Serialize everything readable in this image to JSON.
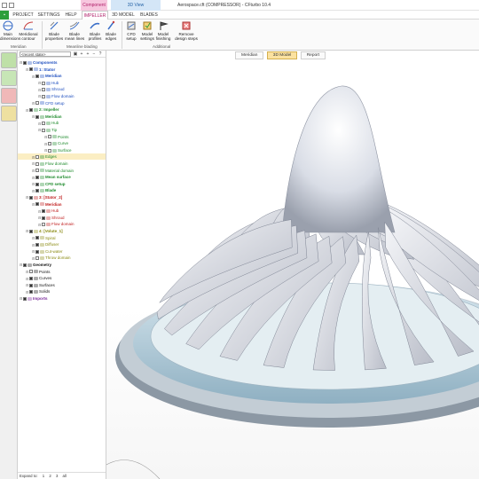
{
  "window": {
    "title": "Aerospace.cft (COMPRESSOR) - CFturbo 10.4",
    "context_component": "Component",
    "context_3d": "3D View"
  },
  "ribbon_tabs": [
    "PROJECT",
    "SETTINGS",
    "HELP",
    "IMPELLER",
    "3D MODEL",
    "BLADES"
  ],
  "ribbon": {
    "buttons": [
      {
        "label": "Main\ndimensions",
        "icon": "main-dimensions-icon"
      },
      {
        "label": "Meridional\ncontour",
        "icon": "meridional-contour-icon"
      },
      {
        "label": "Blade\nproperties",
        "icon": "blade-properties-icon"
      },
      {
        "label": "Blade\nmean lines",
        "icon": "blade-mean-lines-icon"
      },
      {
        "label": "Blade\nprofiles",
        "icon": "blade-profiles-icon"
      },
      {
        "label": "Blade\nedges",
        "icon": "blade-edges-icon"
      },
      {
        "label": "CFD\nsetup",
        "icon": "cfd-setup-icon"
      },
      {
        "label": "Model\nsettings",
        "icon": "model-settings-icon"
      },
      {
        "label": "Model\nfinishing",
        "icon": "model-finishing-icon"
      },
      {
        "label": "Remove\ndesign steps",
        "icon": "remove-design-steps-icon"
      }
    ],
    "groups": [
      "Meridian",
      "Meanline blading",
      "Additional"
    ]
  },
  "tree": {
    "state_select": "<recent state>",
    "items": [
      {
        "label": "Components",
        "color": "#1f4fbf",
        "indent": 0,
        "checked": true,
        "bold": true
      },
      {
        "label": "1: Stator",
        "color": "#1f4fbf",
        "indent": 1,
        "checked": true,
        "bold": true
      },
      {
        "label": "Meridian",
        "color": "#1f4fbf",
        "indent": 2,
        "checked": true,
        "bold": true
      },
      {
        "label": "Hub",
        "color": "#1f4fbf",
        "indent": 3,
        "checked": false
      },
      {
        "label": "Shroud",
        "color": "#1f4fbf",
        "indent": 3,
        "checked": false
      },
      {
        "label": "Flow domain",
        "color": "#1f4fbf",
        "indent": 3,
        "checked": false
      },
      {
        "label": "CFD setup",
        "color": "#1f4fbf",
        "indent": 2,
        "checked": false
      },
      {
        "label": "2: Impeller",
        "color": "#1d8a2b",
        "indent": 1,
        "checked": true,
        "bold": true
      },
      {
        "label": "Meridian",
        "color": "#1d8a2b",
        "indent": 2,
        "checked": true,
        "bold": true
      },
      {
        "label": "Hub",
        "color": "#1d8a2b",
        "indent": 3,
        "checked": false
      },
      {
        "label": "Tip",
        "color": "#1d8a2b",
        "indent": 3,
        "checked": false
      },
      {
        "label": "Points",
        "color": "#1d8a2b",
        "indent": 4,
        "checked": false
      },
      {
        "label": "Curve",
        "color": "#1d8a2b",
        "indent": 4,
        "checked": false
      },
      {
        "label": "Surface",
        "color": "#1d8a2b",
        "indent": 4,
        "checked": false
      },
      {
        "label": "Edges",
        "color": "#1d8a2b",
        "indent": 2,
        "checked": false,
        "highlight": true
      },
      {
        "label": "Flow domain",
        "color": "#1d8a2b",
        "indent": 2,
        "checked": false
      },
      {
        "label": "Material domain",
        "color": "#1d8a2b",
        "indent": 2,
        "checked": false
      },
      {
        "label": "Mean surface",
        "color": "#1d8a2b",
        "indent": 2,
        "checked": true,
        "bold": true
      },
      {
        "label": "CFD setup",
        "color": "#1d8a2b",
        "indent": 2,
        "checked": true,
        "bold": true
      },
      {
        "label": "Blade",
        "color": "#1d8a2b",
        "indent": 2,
        "checked": true,
        "bold": true
      },
      {
        "label": "3: [Stator_2]",
        "color": "#c02020",
        "indent": 1,
        "checked": true,
        "bold": true
      },
      {
        "label": "Meridian",
        "color": "#c02020",
        "indent": 2,
        "checked": true,
        "bold": true
      },
      {
        "label": "Hub",
        "color": "#c02020",
        "indent": 3,
        "checked": true
      },
      {
        "label": "Shroud",
        "color": "#c02020",
        "indent": 3,
        "checked": true
      },
      {
        "label": "Flow domain",
        "color": "#c02020",
        "indent": 3,
        "checked": false
      },
      {
        "label": "4: [Volute_1]",
        "color": "#8a8a10",
        "indent": 1,
        "checked": true,
        "bold": true
      },
      {
        "label": "Spiral",
        "color": "#8a8a10",
        "indent": 2,
        "checked": true
      },
      {
        "label": "Diffuser",
        "color": "#8a8a10",
        "indent": 2,
        "checked": true
      },
      {
        "label": "Cut-water",
        "color": "#8a8a10",
        "indent": 2,
        "checked": true
      },
      {
        "label": "Throw domain",
        "color": "#8a8a10",
        "indent": 2,
        "checked": false
      },
      {
        "label": "Geometry",
        "color": "#111111",
        "indent": 0,
        "checked": true,
        "bold": true
      },
      {
        "label": "Points",
        "color": "#111111",
        "indent": 1,
        "checked": false
      },
      {
        "label": "Curves",
        "color": "#111111",
        "indent": 1,
        "checked": true
      },
      {
        "label": "Surfaces",
        "color": "#111111",
        "indent": 1,
        "checked": true
      },
      {
        "label": "Solids",
        "color": "#111111",
        "indent": 1,
        "checked": true
      },
      {
        "label": "Imports",
        "color": "#7a2a9a",
        "indent": 0,
        "checked": true,
        "bold": true
      }
    ],
    "expand_to": {
      "label": "Expand to:",
      "levels": [
        "1",
        "2",
        "3",
        "all"
      ]
    }
  },
  "view_tabs": [
    "Meridian",
    "3D Model",
    "Report"
  ],
  "view_tab_active": "3D Model",
  "colors": {
    "accent": "#b0206a",
    "file_tab": "#2e9e3a",
    "active_view_tab": "#fbe2a0",
    "highlight_row": "#fbeec3"
  }
}
